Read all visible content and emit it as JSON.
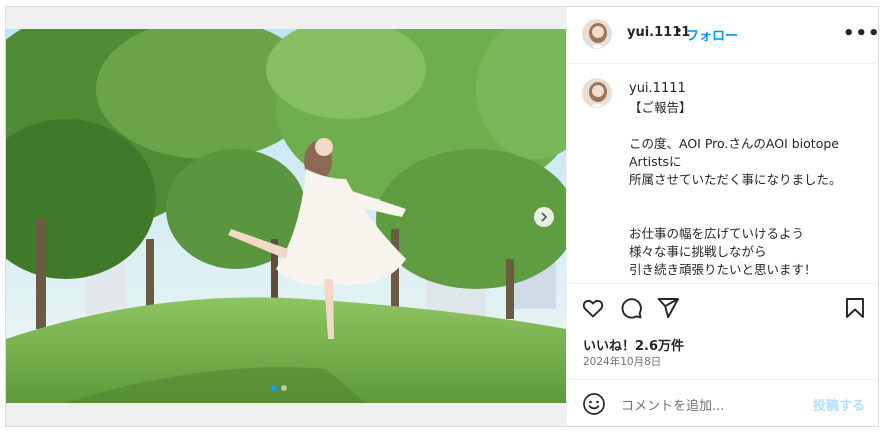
{
  "post": {
    "username": "yui.1111",
    "bullet": "•",
    "follow_label": "フォロー",
    "more_label": "•••",
    "caption_username": "yui.1111",
    "caption": "【ご報告】\n\nこの度、AOI Pro.さんのAOI biotope Artistsに\n所属させていただく事になりました。\n\n\nお仕事の幅を広げていけるよう\n様々な事に挑戦しながら\n引き続き頑張りたいと思います！",
    "likes": "いいね！2.6万件",
    "date": "2024年10月8日",
    "comment_placeholder": "コメントを追加...",
    "post_button": "投稿する",
    "carousel": {
      "total": 2,
      "active_index": 0
    }
  },
  "colors": {
    "accent": "#0095f6",
    "carousel_dot_active": "#1a9bf0",
    "post_button_disabled": "#b2dffc",
    "text": "#262626",
    "muted": "#737373",
    "divider": "#efefef"
  },
  "icons": {
    "like": "heart-icon",
    "comment": "comment-bubble-icon",
    "share": "paper-plane-icon",
    "save": "bookmark-icon",
    "emoji": "smiley-icon",
    "next": "chevron-right-icon"
  }
}
